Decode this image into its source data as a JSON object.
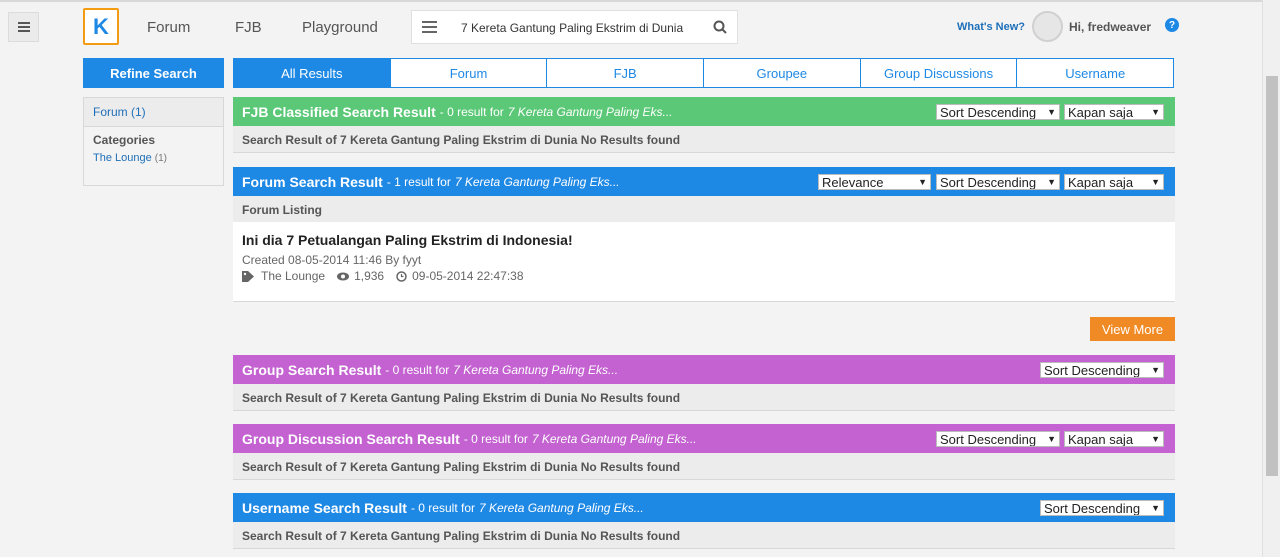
{
  "header": {
    "logo_text": "K",
    "nav": [
      "Forum",
      "FJB",
      "Playground"
    ],
    "search_query": "7 Kereta Gantung Paling Ekstrim di Dunia",
    "whats_new": "What's New?",
    "greeting": "Hi, fredweaver",
    "help": "?"
  },
  "sidebar": {
    "refine": "Refine Search",
    "forum_filter": "Forum (1)",
    "categories_title": "Categories",
    "category_name": "The Lounge",
    "category_count": "(1)"
  },
  "tabs": [
    "All Results",
    "Forum",
    "FJB",
    "Groupee",
    "Group Discussions",
    "Username"
  ],
  "sort": {
    "desc": "Sort Descending",
    "time": "Kapan saja",
    "relevance": "Relevance"
  },
  "sections": {
    "fjb": {
      "title": "FJB Classified Search Result",
      "count": "- 0 result for",
      "query": "7 Kereta Gantung Paling Eks...",
      "sub": "Search Result of 7 Kereta Gantung Paling Ekstrim di Dunia No Results found"
    },
    "forum": {
      "title": "Forum Search Result",
      "count": "- 1 result for",
      "query": "7 Kereta Gantung Paling Eks...",
      "sub": "Forum Listing",
      "item": {
        "title": "Ini dia 7 Petualangan Paling Ekstrim di Indonesia!",
        "created": "Created 08-05-2014 11:46 By fyyt",
        "category": "The Lounge",
        "views": "1,936",
        "time": "09-05-2014 22:47:38"
      },
      "view_more": "View More"
    },
    "group": {
      "title": "Group Search Result",
      "count": "- 0 result for",
      "query": "7 Kereta Gantung Paling Eks...",
      "sub": "Search Result of 7 Kereta Gantung Paling Ekstrim di Dunia No Results found"
    },
    "group_discussion": {
      "title": "Group Discussion Search Result",
      "count": "- 0 result for",
      "query": "7 Kereta Gantung Paling Eks...",
      "sub": "Search Result of 7 Kereta Gantung Paling Ekstrim di Dunia No Results found"
    },
    "username": {
      "title": "Username Search Result",
      "count": "- 0 result for",
      "query": "7 Kereta Gantung Paling Eks...",
      "sub": "Search Result of 7 Kereta Gantung Paling Ekstrim di Dunia No Results found"
    }
  },
  "colors": {
    "primary": "#1e88e5",
    "fjb": "#5ac876",
    "group": "#c362d0",
    "orange": "#f08a24"
  }
}
